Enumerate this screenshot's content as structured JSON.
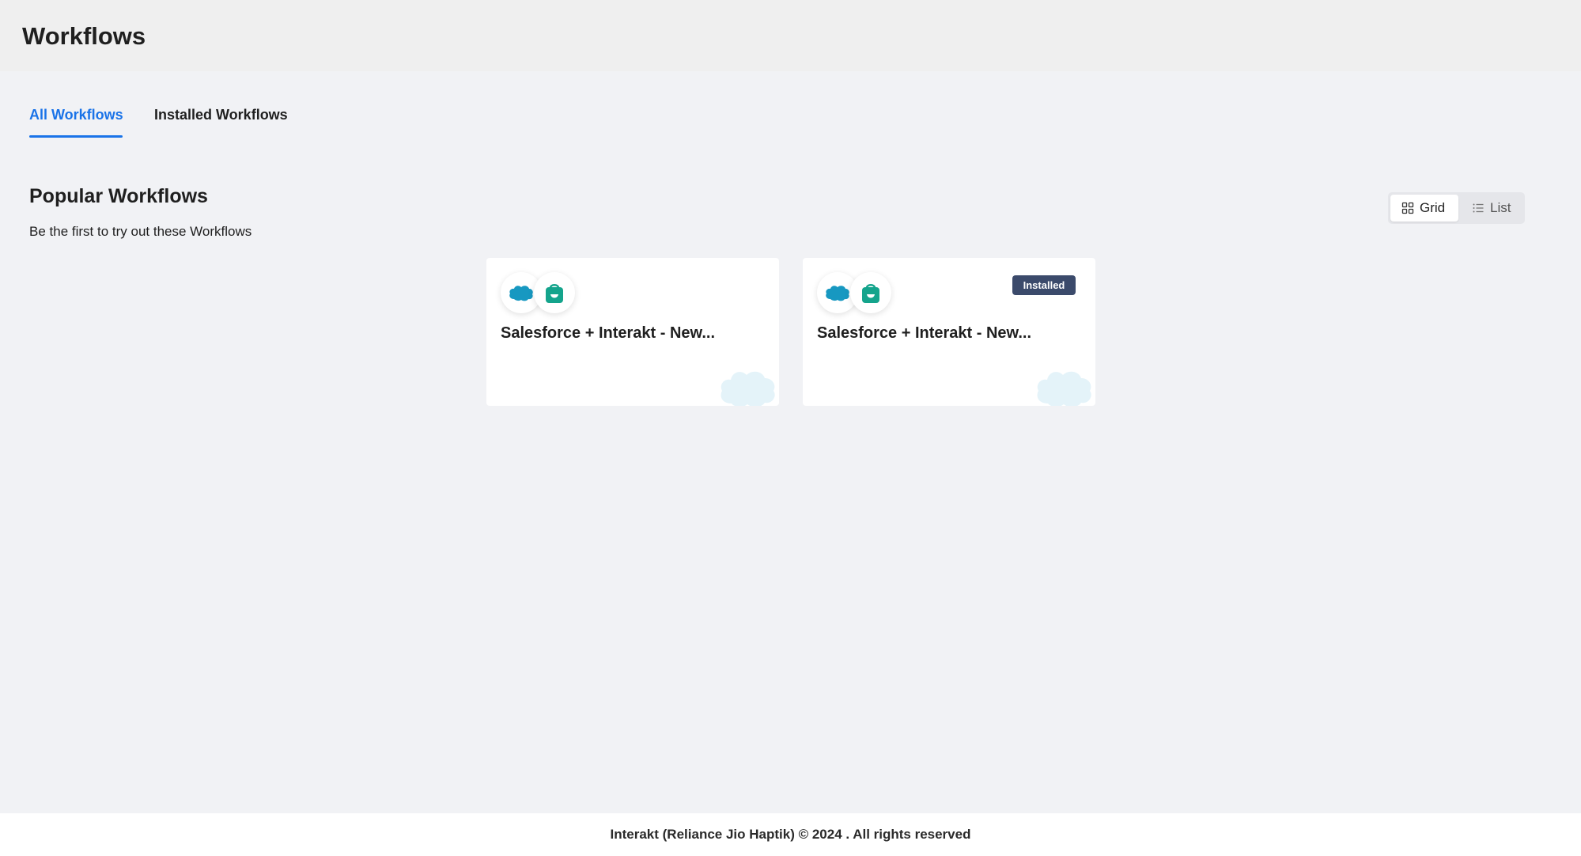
{
  "header": {
    "title": "Workflows"
  },
  "tabs": [
    {
      "label": "All Workflows",
      "active": true
    },
    {
      "label": "Installed Workflows",
      "active": false
    }
  ],
  "section": {
    "title": "Popular Workflows",
    "subtitle": "Be the first to try out these Workflows"
  },
  "view_toggle": {
    "options": [
      {
        "label": "Grid",
        "icon": "grid-icon",
        "selected": true
      },
      {
        "label": "List",
        "icon": "list-icon",
        "selected": false
      }
    ]
  },
  "cards": [
    {
      "title": "Salesforce + Interakt - New...",
      "logos": [
        "salesforce-logo",
        "interakt-logo"
      ],
      "badge": null,
      "watermark_text": "salesforce"
    },
    {
      "title": "Salesforce + Interakt - New...",
      "logos": [
        "salesforce-logo",
        "interakt-logo"
      ],
      "badge": "Installed",
      "watermark_text": "salesforce"
    }
  ],
  "footer": {
    "text": "Interakt (Reliance Jio Haptik) © 2024 . All rights reserved"
  },
  "colors": {
    "accent": "#1a73e8",
    "badge_bg": "#3b4a6b",
    "salesforce_blue": "#1798c1",
    "interakt_green": "#14a48c"
  }
}
